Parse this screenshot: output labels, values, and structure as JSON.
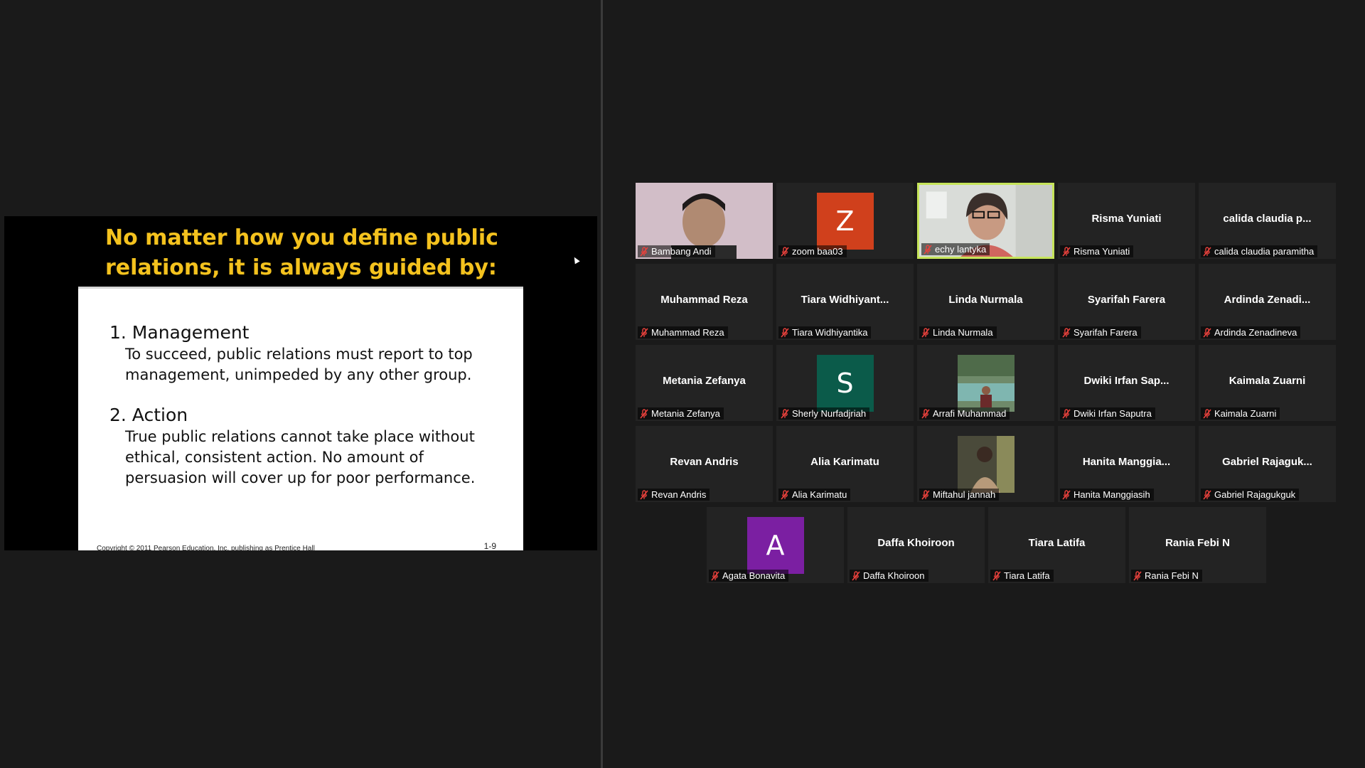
{
  "slide": {
    "title": "No matter how you define public relations, it is always guided by:",
    "points": [
      {
        "heading": "1. Management",
        "body": "To succeed, public relations must report to top management, unimpeded by any other group."
      },
      {
        "heading": "2. Action",
        "body": "True public relations cannot take place without ethical, consistent action. No amount of persuasion will cover up for poor performance."
      }
    ],
    "copyright": "Copyright © 2011 Pearson Education, Inc. publishing as Prentice Hall",
    "page_number": "1-9"
  },
  "colors": {
    "title_yellow": "#f4c21e",
    "active_speaker_border": "#c6e45a",
    "tile_bg": "#232323",
    "mute_red": "#e8413c"
  },
  "participants": [
    {
      "display": "",
      "label": "Bambang Andi",
      "kind": "video"
    },
    {
      "display": "Z",
      "label": "zoom baa03",
      "kind": "initial",
      "color": "#d0401c"
    },
    {
      "display": "",
      "label": "echy lantyka",
      "kind": "video",
      "active": true
    },
    {
      "display": "Risma Yuniati",
      "label": "Risma Yuniati",
      "kind": "name"
    },
    {
      "display": "calida claudia p...",
      "label": "calida claudia paramitha",
      "kind": "name"
    },
    {
      "display": "Muhammad Reza",
      "label": "Muhammad Reza",
      "kind": "name"
    },
    {
      "display": "Tiara Widhiyant...",
      "label": "Tiara Widhiyantika",
      "kind": "name"
    },
    {
      "display": "Linda Nurmala",
      "label": "Linda Nurmala",
      "kind": "name"
    },
    {
      "display": "Syarifah Farera",
      "label": "Syarifah Farera",
      "kind": "name"
    },
    {
      "display": "Ardinda Zenadi...",
      "label": "Ardinda Zenadineva",
      "kind": "name"
    },
    {
      "display": "Metania Zefanya",
      "label": "Metania Zefanya",
      "kind": "name"
    },
    {
      "display": "S",
      "label": "Sherly Nurfadjriah",
      "kind": "initial",
      "color": "#0b5b4a"
    },
    {
      "display": "",
      "label": "Arrafi Muhammad",
      "kind": "photo"
    },
    {
      "display": "Dwiki Irfan Sap...",
      "label": "Dwiki Irfan Saputra",
      "kind": "name"
    },
    {
      "display": "Kaimala Zuarni",
      "label": "Kaimala Zuarni",
      "kind": "name"
    },
    {
      "display": "Revan Andris",
      "label": "Revan Andris",
      "kind": "name"
    },
    {
      "display": "Alia Karimatu",
      "label": "Alia Karimatu",
      "kind": "name"
    },
    {
      "display": "",
      "label": "Miftahul jannah",
      "kind": "photo"
    },
    {
      "display": "Hanita Manggia...",
      "label": "Hanita Manggiasih",
      "kind": "name"
    },
    {
      "display": "Gabriel Rajaguk...",
      "label": "Gabriel Rajagukguk",
      "kind": "name"
    },
    {
      "display": "A",
      "label": "Agata Bonavita",
      "kind": "initial",
      "color": "#7b1fa2"
    },
    {
      "display": "Daffa Khoiroon",
      "label": "Daffa Khoiroon",
      "kind": "name"
    },
    {
      "display": "Tiara Latifa",
      "label": "Tiara Latifa",
      "kind": "name"
    },
    {
      "display": "Rania Febi N",
      "label": "Rania Febi N",
      "kind": "name"
    }
  ]
}
